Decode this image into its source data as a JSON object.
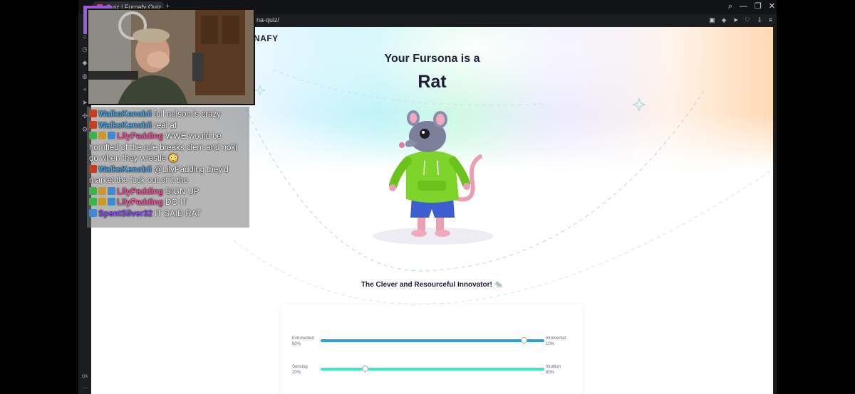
{
  "browser": {
    "tab_title": "Quiz | Furnafy Quiz",
    "new_tab_glyph": "+",
    "url": "na-quiz/",
    "window_controls": [
      "search-icon",
      "minimize-icon",
      "restore-icon",
      "close-icon"
    ],
    "address_icons": [
      "wallet-icon",
      "shield-icon",
      "send-icon",
      "heart-icon",
      "download-icon",
      "menu-icon"
    ],
    "sidebar_icons": [
      "home-icon",
      "clock-icon",
      "bookmark-icon",
      "messenger-icon",
      "add-icon",
      "send-icon",
      "puzzle-icon",
      "settings-icon"
    ],
    "sidebar_bottom": [
      "ox",
      "..."
    ]
  },
  "page": {
    "logo": "NAFY",
    "result_pre": "Your Fursona is a",
    "result_animal": "Rat",
    "tagline": "The Clever and Resourceful Innovator! 🐀",
    "traits": [
      {
        "left": "Extroverted",
        "left_pct": "90%",
        "right": "Introverted",
        "right_pct": "10%",
        "knob": 0.91,
        "color": "#2f9fd9"
      },
      {
        "left": "Sensing",
        "left_pct": "20%",
        "right": "Intuition",
        "right_pct": "80%",
        "knob": 0.2,
        "color": "#3ee6c8"
      }
    ]
  },
  "chat": {
    "messages": [
      {
        "badges": [
          "cake"
        ],
        "user": "WalksKenobii",
        "color": "#4aa3df",
        "text": "full nelson is crazy"
      },
      {
        "badges": [
          "cake"
        ],
        "user": "WalksKenobii",
        "color": "#4aa3df",
        "text": "real af"
      },
      {
        "badges": [
          "mod",
          "gift",
          "sub"
        ],
        "user": "LilyPadding",
        "color": "#ff5aa5",
        "text": "WWE would be horrified of the rule breaks clem and noki do when they wrestle 😳"
      },
      {
        "badges": [
          "cake"
        ],
        "user": "WalksKenobii",
        "color": "#4aa3df",
        "text": "@LilyPadding they'd market the fuck out of it tho"
      },
      {
        "badges": [
          "mod",
          "gift",
          "sub"
        ],
        "user": "LilyPadding",
        "color": "#ff5aa5",
        "text": "SIGN UP"
      },
      {
        "badges": [
          "mod",
          "gift",
          "sub"
        ],
        "user": "LilyPadding",
        "color": "#ff5aa5",
        "text": "DO IT"
      },
      {
        "badges": [
          "sub"
        ],
        "user": "SpentSilver32",
        "color": "#8a4bff",
        "text": "IT SAID RAT"
      }
    ]
  }
}
